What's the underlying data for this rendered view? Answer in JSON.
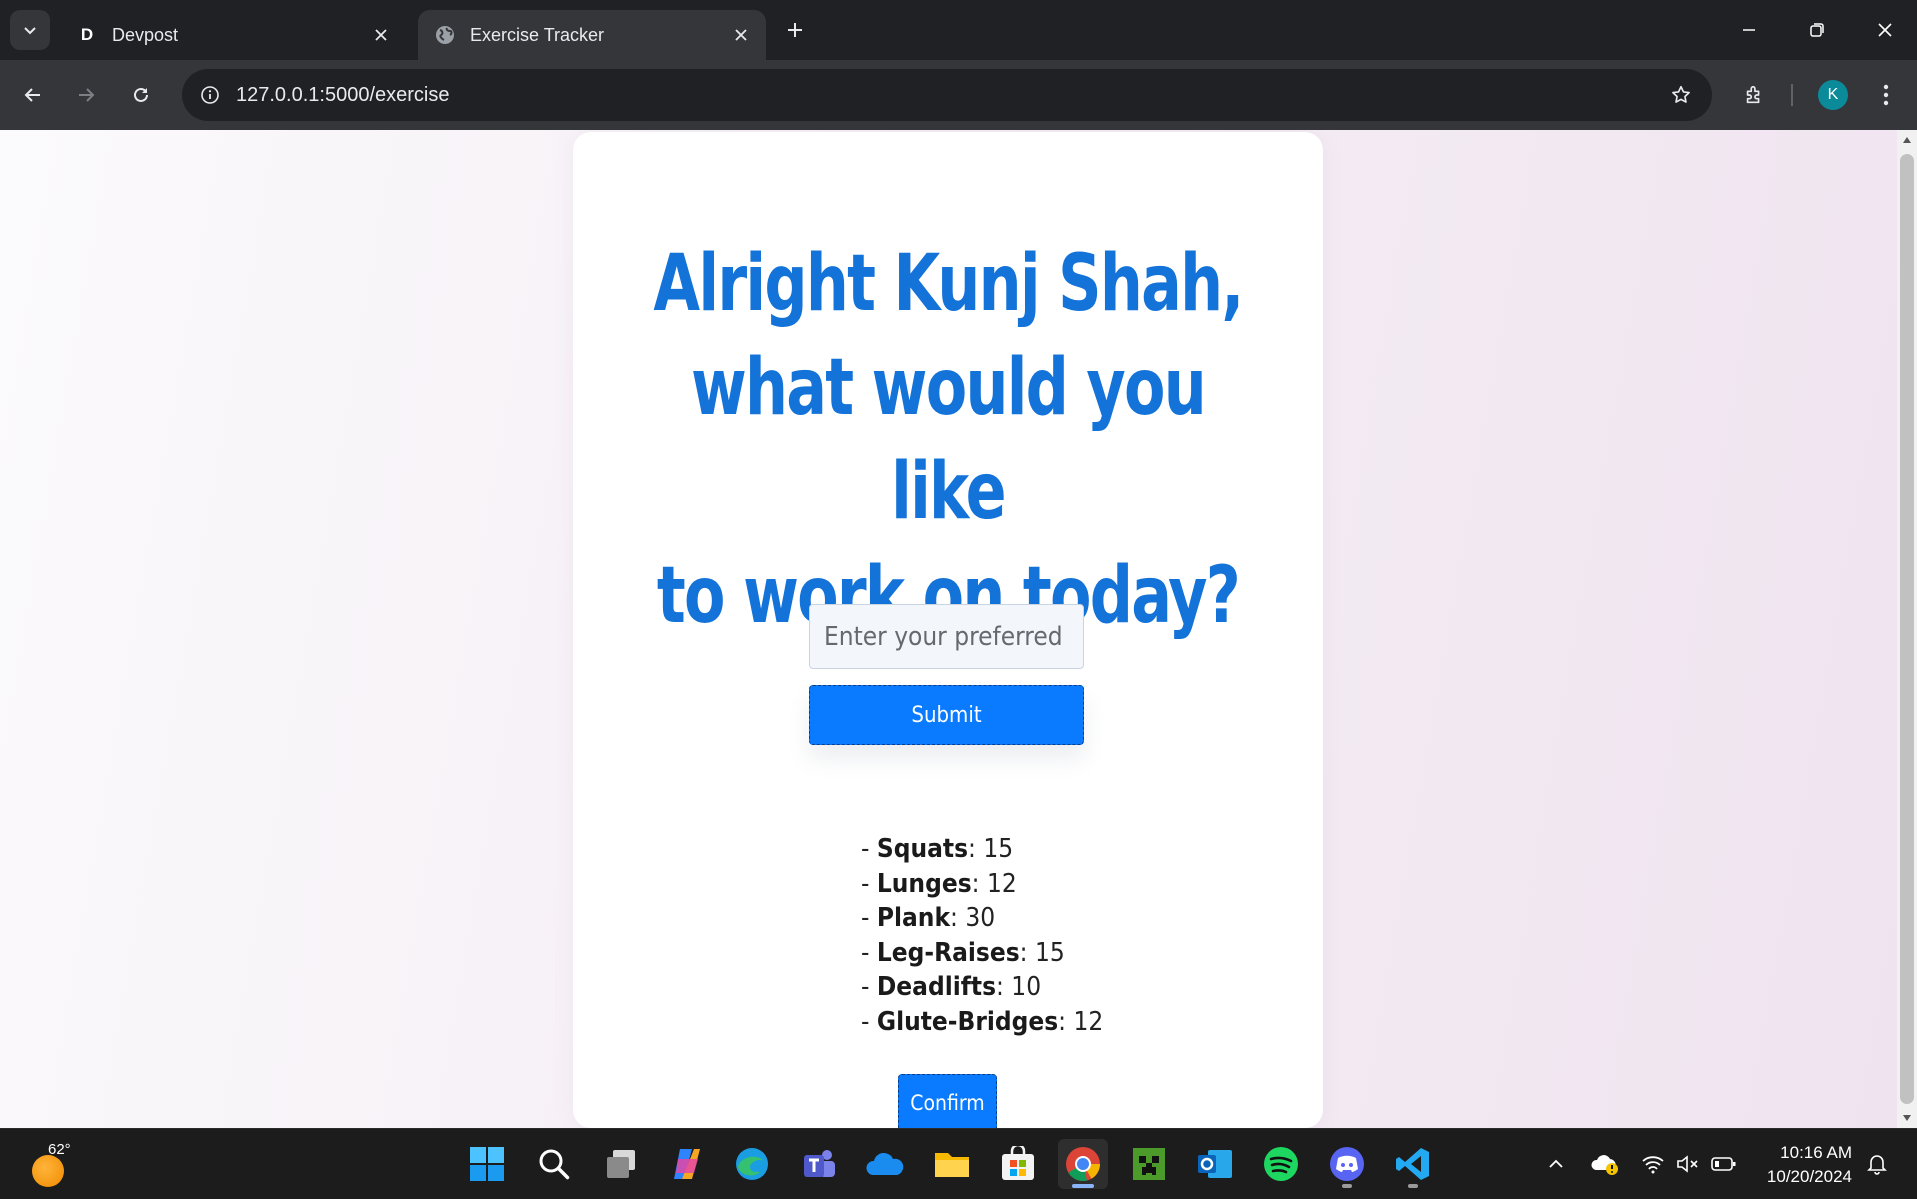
{
  "browser": {
    "tabs": [
      {
        "title": "Devpost",
        "favicon": "D",
        "active": false
      },
      {
        "title": "Exercise Tracker",
        "favicon": "globe-icon",
        "active": true
      }
    ],
    "url": "127.0.0.1:5000/exercise",
    "profile_initial": "K"
  },
  "page": {
    "heading_line1": "Alright Kunj Shah,",
    "heading_line2": "what would you like",
    "heading_line3": "to work on today?",
    "input_placeholder": "Enter your preferred",
    "submit_label": "Submit",
    "exercises": [
      {
        "prefix": "- ",
        "name": "Squats",
        "reps": ": 15"
      },
      {
        "prefix": "- ",
        "name": "Lunges",
        "reps": ": 12"
      },
      {
        "prefix": "- ",
        "name": "Plank",
        "reps": ": 30"
      },
      {
        "prefix": "- ",
        "name": "Leg-Raises",
        "reps": ": 15"
      },
      {
        "prefix": "- ",
        "name": "Deadlifts",
        "reps": ": 10"
      },
      {
        "prefix": "- ",
        "name": "Glute-Bridges",
        "reps": ": 12"
      }
    ],
    "confirm_label": "Confirm",
    "colors": {
      "heading": "#1473d8",
      "button": "#0a7bff"
    }
  },
  "taskbar": {
    "weather_temp": "62°",
    "time": "10:16 AM",
    "date": "10/20/2024",
    "apps": [
      "start",
      "search",
      "task-view",
      "copilot",
      "edge",
      "teams",
      "onedrive",
      "file-explorer",
      "microsoft-store",
      "chrome",
      "minecraft",
      "outlook",
      "spotify",
      "discord",
      "vscode"
    ]
  }
}
